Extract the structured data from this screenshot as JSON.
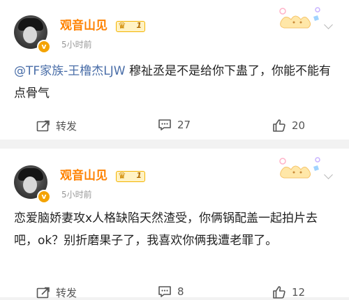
{
  "posts": [
    {
      "username": "观音山见",
      "level": "1",
      "time": "5小时前",
      "mention": "@TF家族-王橹杰LJW",
      "body": " 穆祉丞是不是给你下蛊了，你能不能有点骨气",
      "actions": {
        "repost_label": "转发",
        "comment_count": "27",
        "like_count": "20"
      }
    },
    {
      "username": "观音山见",
      "level": "1",
      "time": "5小时前",
      "mention": "",
      "body": "恋爱脑娇妻攻x人格缺陷天然渣受，你俩锅配盖一起拍片去吧，ok？别折磨果子了，我喜欢你俩我遭老罪了。",
      "actions": {
        "repost_label": "转发",
        "comment_count": "8",
        "like_count": "12"
      }
    }
  ],
  "colors": {
    "username": "#ff8200",
    "mention": "#4a6ea8",
    "badge": "#f4a300",
    "background": "#f2f2f2"
  },
  "icons": [
    "verified-badge-icon",
    "crown-icon",
    "chevron-down-icon",
    "repost-icon",
    "comment-icon",
    "like-icon"
  ]
}
